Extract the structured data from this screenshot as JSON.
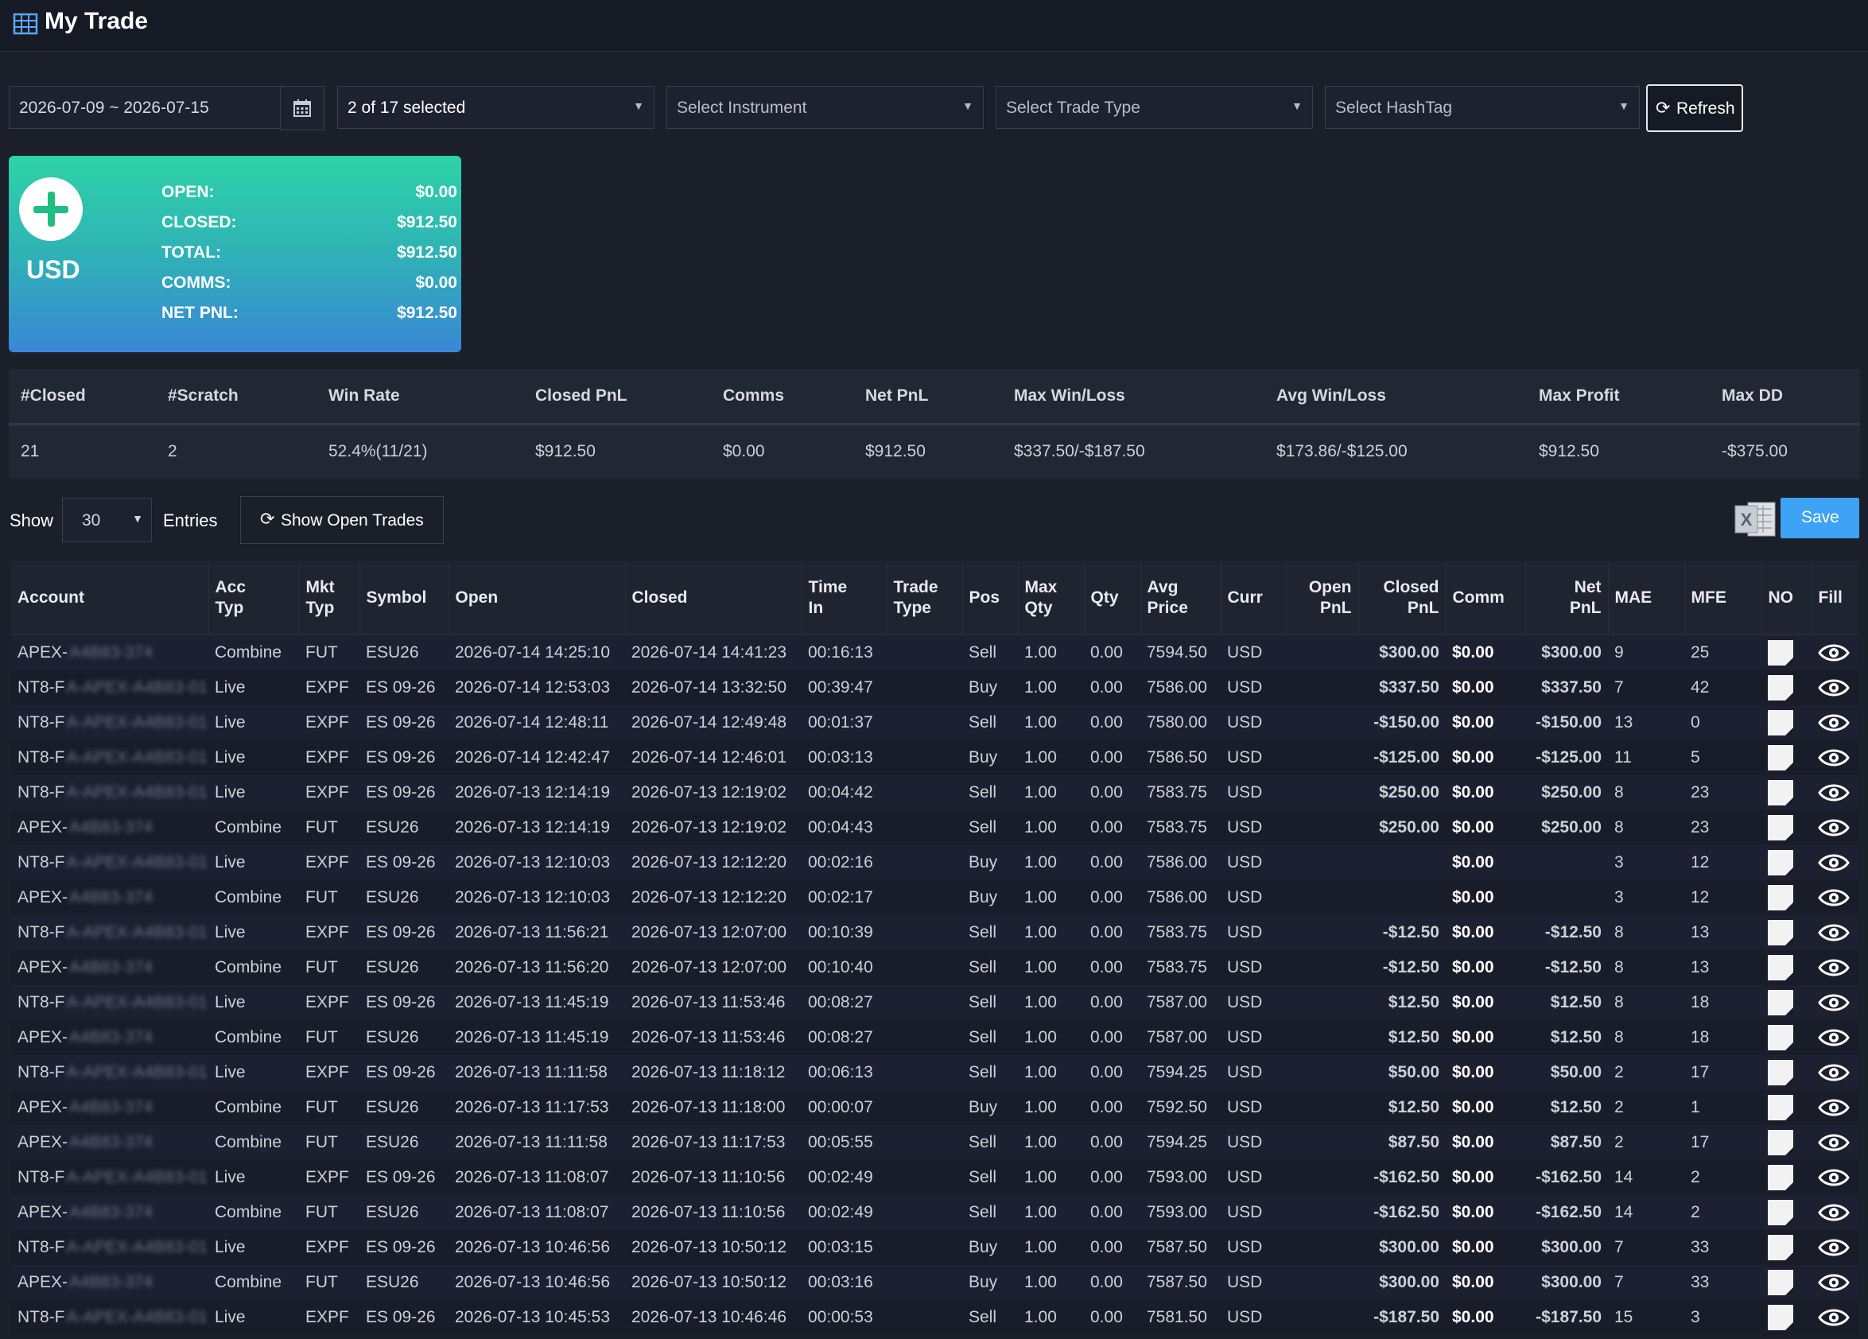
{
  "header": {
    "title": "My Trade",
    "icon": "grid-icon"
  },
  "filters": {
    "date_range": "2026-07-09 ~ 2026-07-15",
    "accounts": "2 of 17 selected",
    "instrument": "Select Instrument",
    "trade_type": "Select Trade Type",
    "hashtag": "Select HashTag",
    "refresh_label": "Refresh"
  },
  "currency_card": {
    "currency": "USD",
    "rows": [
      {
        "label": "OPEN:",
        "value": "$0.00"
      },
      {
        "label": "CLOSED:",
        "value": "$912.50"
      },
      {
        "label": "TOTAL:",
        "value": "$912.50"
      },
      {
        "label": "COMMS:",
        "value": "$0.00"
      },
      {
        "label": "NET PNL:",
        "value": "$912.50"
      }
    ]
  },
  "summary": {
    "headers": [
      "#Closed",
      "#Scratch",
      "Win Rate",
      "Closed PnL",
      "Comms",
      "Net PnL",
      "Max Win/Loss",
      "Avg Win/Loss",
      "Max Profit",
      "Max DD"
    ],
    "values": [
      "21",
      "2",
      "52.4%(11/21)",
      "$912.50",
      "$0.00",
      "$912.50",
      "$337.50/-$187.50",
      "$173.86/-$125.00",
      "$912.50",
      "-$375.00"
    ]
  },
  "controls": {
    "show_label": "Show",
    "entries_value": "30",
    "entries_label": "Entries",
    "show_open_trades_label": "Show Open Trades",
    "save_label": "Save"
  },
  "colors": {
    "positive": "#1ed37a",
    "negative": "#ff3d4f",
    "accent": "#3ea3f5"
  },
  "table": {
    "headers": [
      "Account",
      "Acc Typ",
      "Mkt Typ",
      "Symbol",
      "Open",
      "Closed",
      "Time In",
      "Trade Type",
      "Pos",
      "Max Qty",
      "Qty",
      "Avg Price",
      "Curr",
      "Open PnL",
      "Closed PnL",
      "Comm",
      "Net PnL",
      "MAE",
      "MFE",
      "NO",
      "Fill"
    ],
    "rows": [
      {
        "acct": "APEX-",
        "acct_hidden": "A4B83-374",
        "acc_typ": "Combine",
        "mkt": "FUT",
        "sym": "ESU26",
        "open": "2026-07-14 14:25:10",
        "closed": "2026-07-14 14:41:23",
        "time": "00:16:13",
        "type": "",
        "pos": "Sell",
        "maxq": "1.00",
        "qty": "0.00",
        "avg": "7594.50",
        "curr": "USD",
        "openpnl": "",
        "closedpnl": "$300.00",
        "comm": "$0.00",
        "net": "$300.00",
        "mae": "9",
        "mfe": "25",
        "sign": "pos"
      },
      {
        "acct": "NT8-F",
        "acct_hidden": "A-APEX-A4B83-01",
        "acc_typ": "Live",
        "mkt": "EXPF",
        "sym": "ES 09-26",
        "open": "2026-07-14 12:53:03",
        "closed": "2026-07-14 13:32:50",
        "time": "00:39:47",
        "type": "",
        "pos": "Buy",
        "maxq": "1.00",
        "qty": "0.00",
        "avg": "7586.00",
        "curr": "USD",
        "openpnl": "",
        "closedpnl": "$337.50",
        "comm": "$0.00",
        "net": "$337.50",
        "mae": "7",
        "mfe": "42",
        "sign": "pos"
      },
      {
        "acct": "NT8-F",
        "acct_hidden": "A-APEX-A4B83-01",
        "acc_typ": "Live",
        "mkt": "EXPF",
        "sym": "ES 09-26",
        "open": "2026-07-14 12:48:11",
        "closed": "2026-07-14 12:49:48",
        "time": "00:01:37",
        "type": "",
        "pos": "Sell",
        "maxq": "1.00",
        "qty": "0.00",
        "avg": "7580.00",
        "curr": "USD",
        "openpnl": "",
        "closedpnl": "-$150.00",
        "comm": "$0.00",
        "net": "-$150.00",
        "mae": "13",
        "mfe": "0",
        "sign": "neg"
      },
      {
        "acct": "NT8-F",
        "acct_hidden": "A-APEX-A4B83-01",
        "acc_typ": "Live",
        "mkt": "EXPF",
        "sym": "ES 09-26",
        "open": "2026-07-14 12:42:47",
        "closed": "2026-07-14 12:46:01",
        "time": "00:03:13",
        "type": "",
        "pos": "Buy",
        "maxq": "1.00",
        "qty": "0.00",
        "avg": "7586.50",
        "curr": "USD",
        "openpnl": "",
        "closedpnl": "-$125.00",
        "comm": "$0.00",
        "net": "-$125.00",
        "mae": "11",
        "mfe": "5",
        "sign": "neg"
      },
      {
        "acct": "NT8-F",
        "acct_hidden": "A-APEX-A4B83-01",
        "acc_typ": "Live",
        "mkt": "EXPF",
        "sym": "ES 09-26",
        "open": "2026-07-13 12:14:19",
        "closed": "2026-07-13 12:19:02",
        "time": "00:04:42",
        "type": "",
        "pos": "Sell",
        "maxq": "1.00",
        "qty": "0.00",
        "avg": "7583.75",
        "curr": "USD",
        "openpnl": "",
        "closedpnl": "$250.00",
        "comm": "$0.00",
        "net": "$250.00",
        "mae": "8",
        "mfe": "23",
        "sign": "pos"
      },
      {
        "acct": "APEX-",
        "acct_hidden": "A4B83-374",
        "acc_typ": "Combine",
        "mkt": "FUT",
        "sym": "ESU26",
        "open": "2026-07-13 12:14:19",
        "closed": "2026-07-13 12:19:02",
        "time": "00:04:43",
        "type": "",
        "pos": "Sell",
        "maxq": "1.00",
        "qty": "0.00",
        "avg": "7583.75",
        "curr": "USD",
        "openpnl": "",
        "closedpnl": "$250.00",
        "comm": "$0.00",
        "net": "$250.00",
        "mae": "8",
        "mfe": "23",
        "sign": "pos"
      },
      {
        "acct": "NT8-F",
        "acct_hidden": "A-APEX-A4B83-01",
        "acc_typ": "Live",
        "mkt": "EXPF",
        "sym": "ES 09-26",
        "open": "2026-07-13 12:10:03",
        "closed": "2026-07-13 12:12:20",
        "time": "00:02:16",
        "type": "",
        "pos": "Buy",
        "maxq": "1.00",
        "qty": "0.00",
        "avg": "7586.00",
        "curr": "USD",
        "openpnl": "",
        "closedpnl": "",
        "comm": "$0.00",
        "net": "",
        "mae": "3",
        "mfe": "12",
        "sign": ""
      },
      {
        "acct": "APEX-",
        "acct_hidden": "A4B83-374",
        "acc_typ": "Combine",
        "mkt": "FUT",
        "sym": "ESU26",
        "open": "2026-07-13 12:10:03",
        "closed": "2026-07-13 12:12:20",
        "time": "00:02:17",
        "type": "",
        "pos": "Buy",
        "maxq": "1.00",
        "qty": "0.00",
        "avg": "7586.00",
        "curr": "USD",
        "openpnl": "",
        "closedpnl": "",
        "comm": "$0.00",
        "net": "",
        "mae": "3",
        "mfe": "12",
        "sign": ""
      },
      {
        "acct": "NT8-F",
        "acct_hidden": "A-APEX-A4B83-01",
        "acc_typ": "Live",
        "mkt": "EXPF",
        "sym": "ES 09-26",
        "open": "2026-07-13 11:56:21",
        "closed": "2026-07-13 12:07:00",
        "time": "00:10:39",
        "type": "",
        "pos": "Sell",
        "maxq": "1.00",
        "qty": "0.00",
        "avg": "7583.75",
        "curr": "USD",
        "openpnl": "",
        "closedpnl": "-$12.50",
        "comm": "$0.00",
        "net": "-$12.50",
        "mae": "8",
        "mfe": "13",
        "sign": "neg"
      },
      {
        "acct": "APEX-",
        "acct_hidden": "A4B83-374",
        "acc_typ": "Combine",
        "mkt": "FUT",
        "sym": "ESU26",
        "open": "2026-07-13 11:56:20",
        "closed": "2026-07-13 12:07:00",
        "time": "00:10:40",
        "type": "",
        "pos": "Sell",
        "maxq": "1.00",
        "qty": "0.00",
        "avg": "7583.75",
        "curr": "USD",
        "openpnl": "",
        "closedpnl": "-$12.50",
        "comm": "$0.00",
        "net": "-$12.50",
        "mae": "8",
        "mfe": "13",
        "sign": "neg"
      },
      {
        "acct": "NT8-F",
        "acct_hidden": "A-APEX-A4B83-01",
        "acc_typ": "Live",
        "mkt": "EXPF",
        "sym": "ES 09-26",
        "open": "2026-07-13 11:45:19",
        "closed": "2026-07-13 11:53:46",
        "time": "00:08:27",
        "type": "",
        "pos": "Sell",
        "maxq": "1.00",
        "qty": "0.00",
        "avg": "7587.00",
        "curr": "USD",
        "openpnl": "",
        "closedpnl": "$12.50",
        "comm": "$0.00",
        "net": "$12.50",
        "mae": "8",
        "mfe": "18",
        "sign": "pos"
      },
      {
        "acct": "APEX-",
        "acct_hidden": "A4B83-374",
        "acc_typ": "Combine",
        "mkt": "FUT",
        "sym": "ESU26",
        "open": "2026-07-13 11:45:19",
        "closed": "2026-07-13 11:53:46",
        "time": "00:08:27",
        "type": "",
        "pos": "Sell",
        "maxq": "1.00",
        "qty": "0.00",
        "avg": "7587.00",
        "curr": "USD",
        "openpnl": "",
        "closedpnl": "$12.50",
        "comm": "$0.00",
        "net": "$12.50",
        "mae": "8",
        "mfe": "18",
        "sign": "pos"
      },
      {
        "acct": "NT8-F",
        "acct_hidden": "A-APEX-A4B83-01",
        "acc_typ": "Live",
        "mkt": "EXPF",
        "sym": "ES 09-26",
        "open": "2026-07-13 11:11:58",
        "closed": "2026-07-13 11:18:12",
        "time": "00:06:13",
        "type": "",
        "pos": "Sell",
        "maxq": "1.00",
        "qty": "0.00",
        "avg": "7594.25",
        "curr": "USD",
        "openpnl": "",
        "closedpnl": "$50.00",
        "comm": "$0.00",
        "net": "$50.00",
        "mae": "2",
        "mfe": "17",
        "sign": "pos"
      },
      {
        "acct": "APEX-",
        "acct_hidden": "A4B83-374",
        "acc_typ": "Combine",
        "mkt": "FUT",
        "sym": "ESU26",
        "open": "2026-07-13 11:17:53",
        "closed": "2026-07-13 11:18:00",
        "time": "00:00:07",
        "type": "",
        "pos": "Buy",
        "maxq": "1.00",
        "qty": "0.00",
        "avg": "7592.50",
        "curr": "USD",
        "openpnl": "",
        "closedpnl": "$12.50",
        "comm": "$0.00",
        "net": "$12.50",
        "mae": "2",
        "mfe": "1",
        "sign": "pos"
      },
      {
        "acct": "APEX-",
        "acct_hidden": "A4B83-374",
        "acc_typ": "Combine",
        "mkt": "FUT",
        "sym": "ESU26",
        "open": "2026-07-13 11:11:58",
        "closed": "2026-07-13 11:17:53",
        "time": "00:05:55",
        "type": "",
        "pos": "Sell",
        "maxq": "1.00",
        "qty": "0.00",
        "avg": "7594.25",
        "curr": "USD",
        "openpnl": "",
        "closedpnl": "$87.50",
        "comm": "$0.00",
        "net": "$87.50",
        "mae": "2",
        "mfe": "17",
        "sign": "pos"
      },
      {
        "acct": "NT8-F",
        "acct_hidden": "A-APEX-A4B83-01",
        "acc_typ": "Live",
        "mkt": "EXPF",
        "sym": "ES 09-26",
        "open": "2026-07-13 11:08:07",
        "closed": "2026-07-13 11:10:56",
        "time": "00:02:49",
        "type": "",
        "pos": "Sell",
        "maxq": "1.00",
        "qty": "0.00",
        "avg": "7593.00",
        "curr": "USD",
        "openpnl": "",
        "closedpnl": "-$162.50",
        "comm": "$0.00",
        "net": "-$162.50",
        "mae": "14",
        "mfe": "2",
        "sign": "neg"
      },
      {
        "acct": "APEX-",
        "acct_hidden": "A4B83-374",
        "acc_typ": "Combine",
        "mkt": "FUT",
        "sym": "ESU26",
        "open": "2026-07-13 11:08:07",
        "closed": "2026-07-13 11:10:56",
        "time": "00:02:49",
        "type": "",
        "pos": "Sell",
        "maxq": "1.00",
        "qty": "0.00",
        "avg": "7593.00",
        "curr": "USD",
        "openpnl": "",
        "closedpnl": "-$162.50",
        "comm": "$0.00",
        "net": "-$162.50",
        "mae": "14",
        "mfe": "2",
        "sign": "neg"
      },
      {
        "acct": "NT8-F",
        "acct_hidden": "A-APEX-A4B83-01",
        "acc_typ": "Live",
        "mkt": "EXPF",
        "sym": "ES 09-26",
        "open": "2026-07-13 10:46:56",
        "closed": "2026-07-13 10:50:12",
        "time": "00:03:15",
        "type": "",
        "pos": "Buy",
        "maxq": "1.00",
        "qty": "0.00",
        "avg": "7587.50",
        "curr": "USD",
        "openpnl": "",
        "closedpnl": "$300.00",
        "comm": "$0.00",
        "net": "$300.00",
        "mae": "7",
        "mfe": "33",
        "sign": "pos"
      },
      {
        "acct": "APEX-",
        "acct_hidden": "A4B83-374",
        "acc_typ": "Combine",
        "mkt": "FUT",
        "sym": "ESU26",
        "open": "2026-07-13 10:46:56",
        "closed": "2026-07-13 10:50:12",
        "time": "00:03:16",
        "type": "",
        "pos": "Buy",
        "maxq": "1.00",
        "qty": "0.00",
        "avg": "7587.50",
        "curr": "USD",
        "openpnl": "",
        "closedpnl": "$300.00",
        "comm": "$0.00",
        "net": "$300.00",
        "mae": "7",
        "mfe": "33",
        "sign": "pos"
      },
      {
        "acct": "NT8-F",
        "acct_hidden": "A-APEX-A4B83-01",
        "acc_typ": "Live",
        "mkt": "EXPF",
        "sym": "ES 09-26",
        "open": "2026-07-13 10:45:53",
        "closed": "2026-07-13 10:46:46",
        "time": "00:00:53",
        "type": "",
        "pos": "Sell",
        "maxq": "1.00",
        "qty": "0.00",
        "avg": "7581.50",
        "curr": "USD",
        "openpnl": "",
        "closedpnl": "-$187.50",
        "comm": "$0.00",
        "net": "-$187.50",
        "mae": "15",
        "mfe": "3",
        "sign": "neg"
      }
    ]
  }
}
